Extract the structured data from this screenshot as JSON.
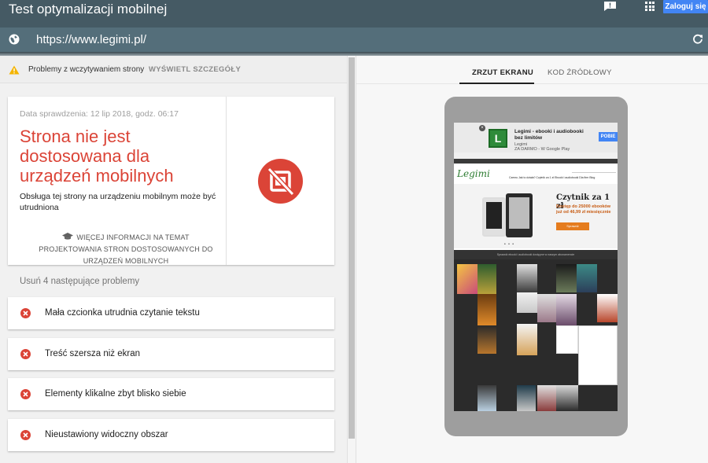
{
  "topbar": {
    "title": "Test optymalizacji mobilnej",
    "feedback_icon": "feedback-icon",
    "apps_icon": "apps-grid-icon",
    "signin_label": "Zaloguj się",
    "bg_color": "#455a64",
    "signin_color": "#4285f4"
  },
  "urlbar": {
    "url": "https://www.legimi.pl/",
    "globe_icon": "globe-icon",
    "reload_icon": "reload-icon"
  },
  "warning": {
    "text": "Problemy z wczytywaniem strony",
    "details_label": "WYŚWIETL SZCZEGÓŁY"
  },
  "result": {
    "date": "Data sprawdzenia: 12 lip 2018, godz. 06:17",
    "headline": "Strona nie jest dostosowana dla urządzeń mobilnych",
    "description": "Obsługa tej strony na urządzeniu mobilnym może być utrudniona",
    "more_info": "WIĘCEJ INFORMACJI NA TEMAT PROJEKTOWANIA STRON DOSTOSOWANYCH DO URZĄDZEŃ MOBILNYCH",
    "status_color": "#db4437"
  },
  "issues": {
    "heading": "Usuń 4 następujące problemy",
    "items": [
      {
        "label": "Mała czcionka utrudnia czytanie tekstu"
      },
      {
        "label": "Treść szersza niż ekran"
      },
      {
        "label": "Elementy klikalne zbyt blisko siebie"
      },
      {
        "label": "Nieustawiony widoczny obszar"
      }
    ]
  },
  "tabs": {
    "screenshot": "ZRZUT EKRANU",
    "source": "KOD ŹRÓDŁOWY"
  },
  "preview": {
    "ad_title": "Legimi - ebooki i audiobooki bez limitów",
    "ad_subtitle": "Legimi\nZA DARMO - W Google Play",
    "ad_button": "POBIE",
    "ad_close": "×",
    "logo": "Legimi",
    "menu": "Czemu    Jak to działa?    Czytnik za 1 zł    Ebooki i audiobooki    Dla firm    Blog",
    "promo_title": "Czytnik za 1 zł",
    "promo_sub": "Dostęp do 25000 ebooków\njuż od 46,99 zł miesięcznie",
    "promo_button": "Sprawdź",
    "dark_strip": "Sprawdź ebooki i audiobooki dostępne w naszym abonamencie",
    "dots": "• • •"
  }
}
